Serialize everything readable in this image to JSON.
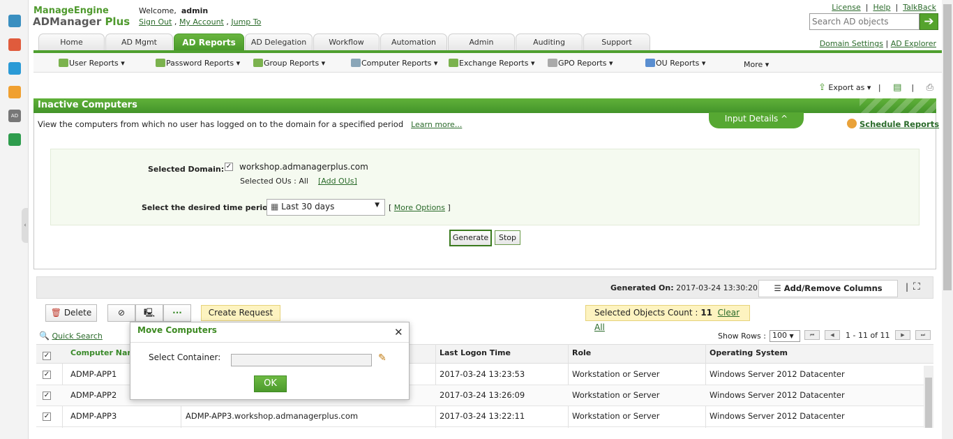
{
  "header": {
    "logo_line1": "ManageEngine",
    "logo_line2a": "ADManager",
    "logo_line2b": " Plus",
    "welcome": "Welcome,",
    "user": "admin",
    "sign_out": "Sign Out",
    "my_account": "My Account",
    "jump_to": "Jump To",
    "license": "License",
    "help": "Help",
    "talkback": "TalkBack",
    "search_placeholder": "Search AD objects",
    "domain_settings": "Domain Settings",
    "ad_explorer": "AD Explorer"
  },
  "tabs": [
    "Home",
    "AD Mgmt",
    "AD Reports",
    "AD Delegation",
    "Workflow",
    "Automation",
    "Admin",
    "Auditing",
    "Support"
  ],
  "subnav": [
    "User Reports",
    "Password Reports",
    "Group Reports",
    "Computer Reports",
    "Exchange Reports",
    "GPO Reports",
    "OU Reports",
    "More"
  ],
  "toolbar": {
    "export_as": "Export as"
  },
  "report": {
    "title": "Inactive Computers",
    "description": "View the computers from which no user has logged on to the domain for a specified period",
    "learn_more": "Learn more...",
    "input_details": "Input Details",
    "schedule_reports": "Schedule Reports",
    "selected_domain_label": "Selected Domain:",
    "domain": "workshop.admanagerplus.com",
    "selected_ous_label": "Selected OUs :",
    "selected_ous_value": "All",
    "add_ous": "[Add OUs]",
    "time_period_label": "Select the desired time period:",
    "time_period_value": "Last 30 days",
    "more_options": "More Options",
    "generate": "Generate",
    "stop": "Stop"
  },
  "results": {
    "generated_on_label": "Generated On:",
    "generated_on_value": "2017-03-24 13:30:20",
    "add_remove_columns": "Add/Remove Columns",
    "delete": "Delete",
    "create_request": "Create Request",
    "selected_objects_label": "Selected Objects Count :",
    "selected_objects_count": "11",
    "clear_all": "Clear All",
    "quick_search": "Quick Search",
    "show_rows_label": "Show Rows :",
    "show_rows_value": "100",
    "page_info": "1 - 11 of  11",
    "columns": [
      "Computer Nam",
      "Last Logon Time",
      "Role",
      "Operating System"
    ],
    "rows": [
      {
        "name": "ADMP-APP1",
        "dns": "",
        "logon": "2017-03-24 13:23:53",
        "role": "Workstation or Server",
        "os": "Windows Server 2012 Datacenter"
      },
      {
        "name": "ADMP-APP2",
        "dns": "",
        "logon": "2017-03-24 13:26:09",
        "role": "Workstation or Server",
        "os": "Windows Server 2012 Datacenter"
      },
      {
        "name": "ADMP-APP3",
        "dns": "ADMP-APP3.workshop.admanagerplus.com",
        "logon": "2017-03-24 13:22:11",
        "role": "Workstation or Server",
        "os": "Windows Server 2012 Datacenter"
      }
    ]
  },
  "modal": {
    "title": "Move Computers",
    "container_label": "Select Container:",
    "ok": "OK"
  },
  "colors": {
    "accent": "#4f9f2f",
    "highlight": "#fdf3c0"
  }
}
